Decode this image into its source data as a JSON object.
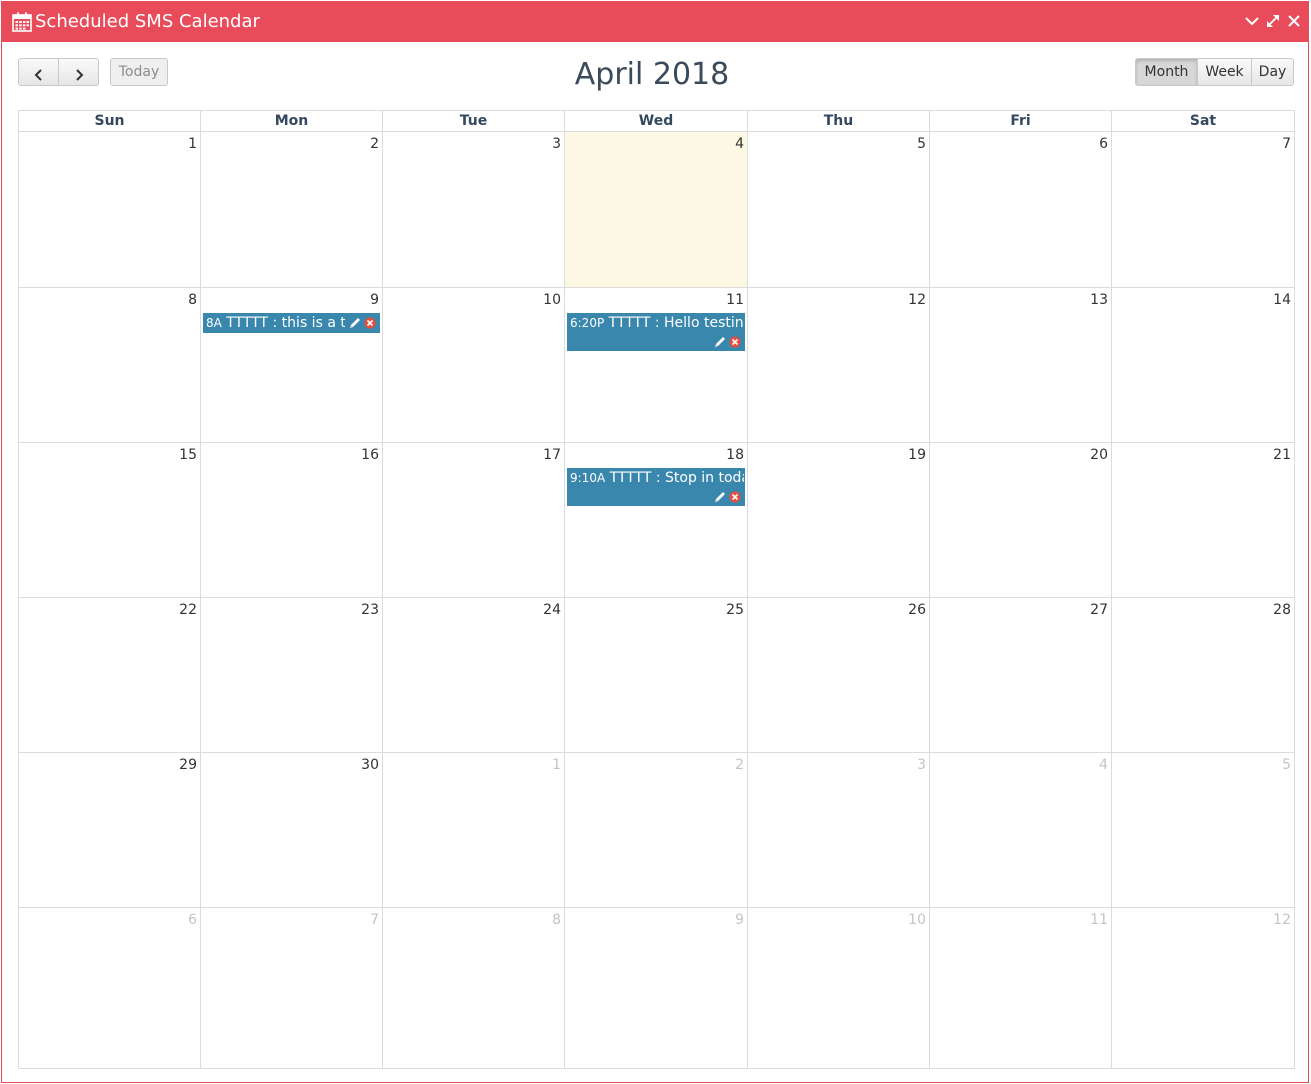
{
  "window": {
    "title": "Scheduled SMS Calendar",
    "accent_color": "#e84c5a",
    "icons": [
      "calendar-icon",
      "chevron-down-icon",
      "expand-icon",
      "close-icon"
    ]
  },
  "toolbar": {
    "prev_icon": "chevron-left-icon",
    "next_icon": "chevron-right-icon",
    "today_label": "Today",
    "title": "April 2018",
    "views": [
      "Month",
      "Week",
      "Day"
    ],
    "active_view": "Month"
  },
  "calendar": {
    "days_of_week": [
      "Sun",
      "Mon",
      "Tue",
      "Wed",
      "Thu",
      "Fri",
      "Sat"
    ],
    "today_highlight": "#fcf8e3",
    "event_color": "#3a87ad",
    "weeks": [
      [
        {
          "day": "1",
          "other": false
        },
        {
          "day": "2",
          "other": false
        },
        {
          "day": "3",
          "other": false
        },
        {
          "day": "4",
          "other": false,
          "today": true
        },
        {
          "day": "5",
          "other": false
        },
        {
          "day": "6",
          "other": false
        },
        {
          "day": "7",
          "other": false
        }
      ],
      [
        {
          "day": "8",
          "other": false
        },
        {
          "day": "9",
          "other": false
        },
        {
          "day": "10",
          "other": false
        },
        {
          "day": "11",
          "other": false
        },
        {
          "day": "12",
          "other": false
        },
        {
          "day": "13",
          "other": false
        },
        {
          "day": "14",
          "other": false
        }
      ],
      [
        {
          "day": "15",
          "other": false
        },
        {
          "day": "16",
          "other": false
        },
        {
          "day": "17",
          "other": false
        },
        {
          "day": "18",
          "other": false
        },
        {
          "day": "19",
          "other": false
        },
        {
          "day": "20",
          "other": false
        },
        {
          "day": "21",
          "other": false
        }
      ],
      [
        {
          "day": "22",
          "other": false
        },
        {
          "day": "23",
          "other": false
        },
        {
          "day": "24",
          "other": false
        },
        {
          "day": "25",
          "other": false
        },
        {
          "day": "26",
          "other": false
        },
        {
          "day": "27",
          "other": false
        },
        {
          "day": "28",
          "other": false
        }
      ],
      [
        {
          "day": "29",
          "other": false
        },
        {
          "day": "30",
          "other": false
        },
        {
          "day": "1",
          "other": true
        },
        {
          "day": "2",
          "other": true
        },
        {
          "day": "3",
          "other": true
        },
        {
          "day": "4",
          "other": true
        },
        {
          "day": "5",
          "other": true
        }
      ],
      [
        {
          "day": "6",
          "other": true
        },
        {
          "day": "7",
          "other": true
        },
        {
          "day": "8",
          "other": true
        },
        {
          "day": "9",
          "other": true
        },
        {
          "day": "10",
          "other": true
        },
        {
          "day": "11",
          "other": true
        },
        {
          "day": "12",
          "other": true
        }
      ]
    ],
    "events": [
      {
        "week": 1,
        "day_index": 1,
        "time": "8A",
        "text": "TTTTT : this is a te",
        "icons": [
          "pencil-icon",
          "delete-icon"
        ],
        "wrapped": false
      },
      {
        "week": 1,
        "day_index": 3,
        "time": "6:20P",
        "text": "TTTTT : Hello testin",
        "icons": [
          "pencil-icon",
          "delete-icon"
        ],
        "wrapped": true
      },
      {
        "week": 2,
        "day_index": 3,
        "time": "9:10A",
        "text": "TTTTT : Stop in toda",
        "icons": [
          "pencil-icon",
          "delete-icon"
        ],
        "wrapped": true
      }
    ]
  }
}
